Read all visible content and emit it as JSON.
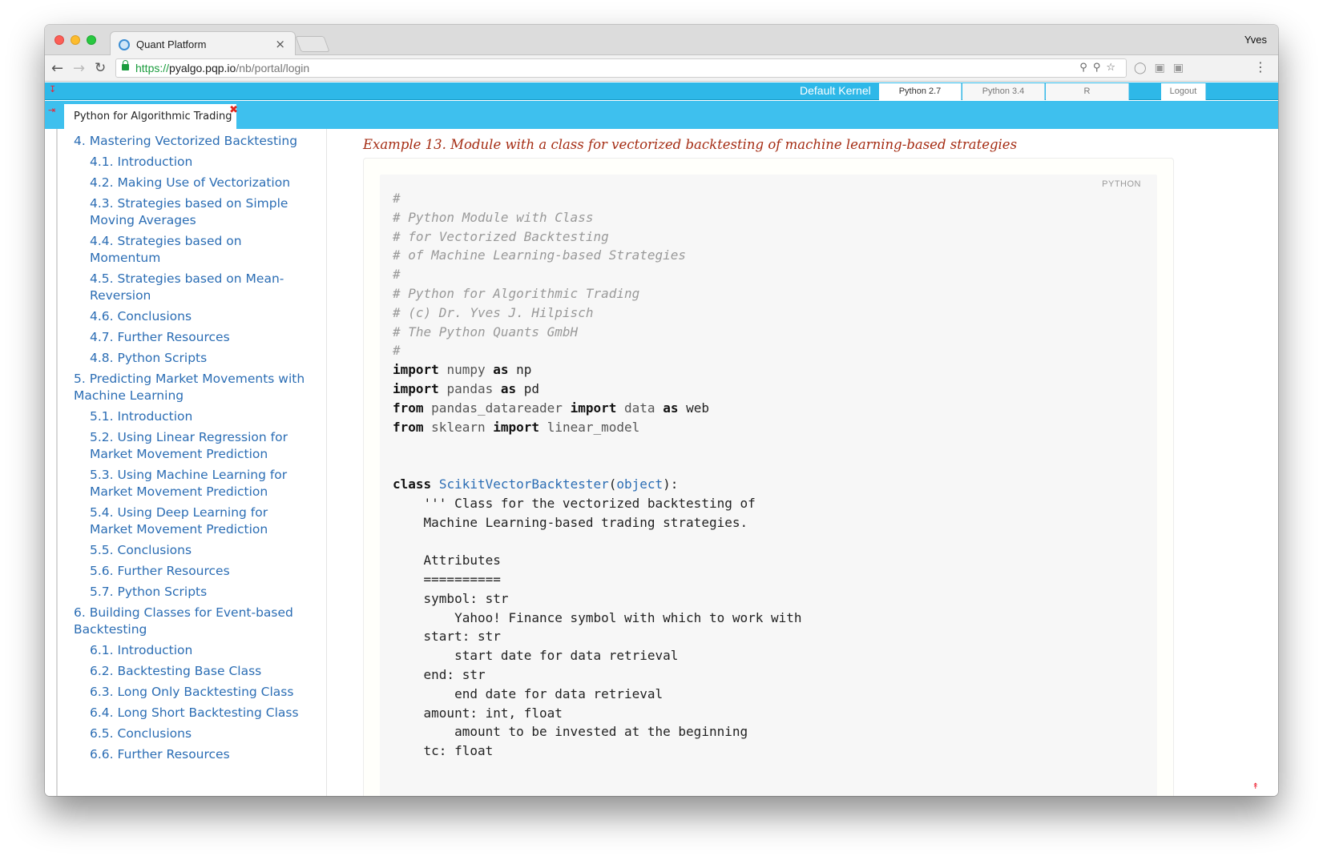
{
  "browser": {
    "tab_title": "Quant Platform",
    "close_glyph": "×",
    "profile_name": "Yves",
    "url_scheme": "https://",
    "url_host": "pyalgo.pqp.io",
    "url_path": "/nb/portal/login"
  },
  "topbar": {
    "kernel_label": "Default Kernel",
    "kernels": [
      "Python 2.7",
      "Python 3.4",
      "R"
    ],
    "logout_label": "Logout"
  },
  "doc_tab": {
    "title": "Python for Algorithmic Trading",
    "close_glyph": "✖"
  },
  "toc": [
    {
      "level": "chapter",
      "label": "4. Mastering Vectorized Backtesting"
    },
    {
      "level": "section",
      "label": "4.1. Introduction"
    },
    {
      "level": "section",
      "label": "4.2. Making Use of Vectorization"
    },
    {
      "level": "section",
      "label": "4.3. Strategies based on Simple Moving Averages"
    },
    {
      "level": "section",
      "label": "4.4. Strategies based on Momentum"
    },
    {
      "level": "section",
      "label": "4.5. Strategies based on Mean-Reversion"
    },
    {
      "level": "section",
      "label": "4.6. Conclusions"
    },
    {
      "level": "section",
      "label": "4.7. Further Resources"
    },
    {
      "level": "section",
      "label": "4.8. Python Scripts"
    },
    {
      "level": "chapter",
      "label": "5. Predicting Market Movements with Machine Learning"
    },
    {
      "level": "section",
      "label": "5.1. Introduction"
    },
    {
      "level": "section",
      "label": "5.2. Using Linear Regression for Market Movement Prediction"
    },
    {
      "level": "section",
      "label": "5.3. Using Machine Learning for Market Movement Prediction"
    },
    {
      "level": "section",
      "label": "5.4. Using Deep Learning for Market Movement Prediction"
    },
    {
      "level": "section",
      "label": "5.5. Conclusions"
    },
    {
      "level": "section",
      "label": "5.6. Further Resources"
    },
    {
      "level": "section",
      "label": "5.7. Python Scripts"
    },
    {
      "level": "chapter",
      "label": "6. Building Classes for Event-based Backtesting"
    },
    {
      "level": "section",
      "label": "6.1. Introduction"
    },
    {
      "level": "section",
      "label": "6.2. Backtesting Base Class"
    },
    {
      "level": "section",
      "label": "6.3. Long Only Backtesting Class"
    },
    {
      "level": "section",
      "label": "6.4. Long Short Backtesting Class"
    },
    {
      "level": "section",
      "label": "6.5. Conclusions"
    },
    {
      "level": "section",
      "label": "6.6. Further Resources"
    }
  ],
  "example": {
    "title": "Example 13. Module with a class for vectorized backtesting of machine learning-based strategies",
    "language": "PYTHON",
    "code_lines": [
      [
        [
          "c",
          "#"
        ]
      ],
      [
        [
          "c",
          "# Python Module with Class"
        ]
      ],
      [
        [
          "c",
          "# for Vectorized Backtesting"
        ]
      ],
      [
        [
          "c",
          "# of Machine Learning-based Strategies"
        ]
      ],
      [
        [
          "c",
          "#"
        ]
      ],
      [
        [
          "c",
          "# Python for Algorithmic Trading"
        ]
      ],
      [
        [
          "c",
          "# (c) Dr. Yves J. Hilpisch"
        ]
      ],
      [
        [
          "c",
          "# The Python Quants GmbH"
        ]
      ],
      [
        [
          "c",
          "#"
        ]
      ],
      [
        [
          "k",
          "import"
        ],
        [
          "t",
          " "
        ],
        [
          "m",
          "numpy"
        ],
        [
          "t",
          " "
        ],
        [
          "k",
          "as"
        ],
        [
          "t",
          " np"
        ]
      ],
      [
        [
          "k",
          "import"
        ],
        [
          "t",
          " "
        ],
        [
          "m",
          "pandas"
        ],
        [
          "t",
          " "
        ],
        [
          "k",
          "as"
        ],
        [
          "t",
          " pd"
        ]
      ],
      [
        [
          "k",
          "from"
        ],
        [
          "t",
          " "
        ],
        [
          "m",
          "pandas_datareader"
        ],
        [
          "t",
          " "
        ],
        [
          "k",
          "import"
        ],
        [
          "t",
          " "
        ],
        [
          "m",
          "data"
        ],
        [
          "t",
          " "
        ],
        [
          "k",
          "as"
        ],
        [
          "t",
          " web"
        ]
      ],
      [
        [
          "k",
          "from"
        ],
        [
          "t",
          " "
        ],
        [
          "m",
          "sklearn"
        ],
        [
          "t",
          " "
        ],
        [
          "k",
          "import"
        ],
        [
          "t",
          " "
        ],
        [
          "m",
          "linear_model"
        ]
      ],
      [
        [
          "t",
          ""
        ]
      ],
      [
        [
          "t",
          ""
        ]
      ],
      [
        [
          "k",
          "class"
        ],
        [
          "t",
          " "
        ],
        [
          "cls",
          "ScikitVectorBacktester"
        ],
        [
          "t",
          "("
        ],
        [
          "bi",
          "object"
        ],
        [
          "t",
          "):"
        ]
      ],
      [
        [
          "t",
          "    ''' Class for the vectorized backtesting of"
        ]
      ],
      [
        [
          "t",
          "    Machine Learning-based trading strategies."
        ]
      ],
      [
        [
          "t",
          ""
        ]
      ],
      [
        [
          "t",
          "    Attributes"
        ]
      ],
      [
        [
          "t",
          "    =========="
        ]
      ],
      [
        [
          "t",
          "    symbol: str"
        ]
      ],
      [
        [
          "t",
          "        Yahoo! Finance symbol with which to work with"
        ]
      ],
      [
        [
          "t",
          "    start: str"
        ]
      ],
      [
        [
          "t",
          "        start date for data retrieval"
        ]
      ],
      [
        [
          "t",
          "    end: str"
        ]
      ],
      [
        [
          "t",
          "        end date for data retrieval"
        ]
      ],
      [
        [
          "t",
          "    amount: int, float"
        ]
      ],
      [
        [
          "t",
          "        amount to be invested at the beginning"
        ]
      ],
      [
        [
          "t",
          "    tc: float"
        ]
      ]
    ]
  },
  "icons": {
    "back": "arrow-left-icon",
    "forward": "arrow-right-icon",
    "reload": "reload-icon",
    "lock": "lock-icon",
    "key": "key-icon",
    "zoom": "zoom-icon",
    "star": "star-icon",
    "menu": "vertical-dots-icon"
  },
  "colors": {
    "accent_blue": "#3ec0ee",
    "link_blue": "#2b6db4",
    "example_title_red": "#a52d14",
    "close_red": "#e0261d"
  }
}
